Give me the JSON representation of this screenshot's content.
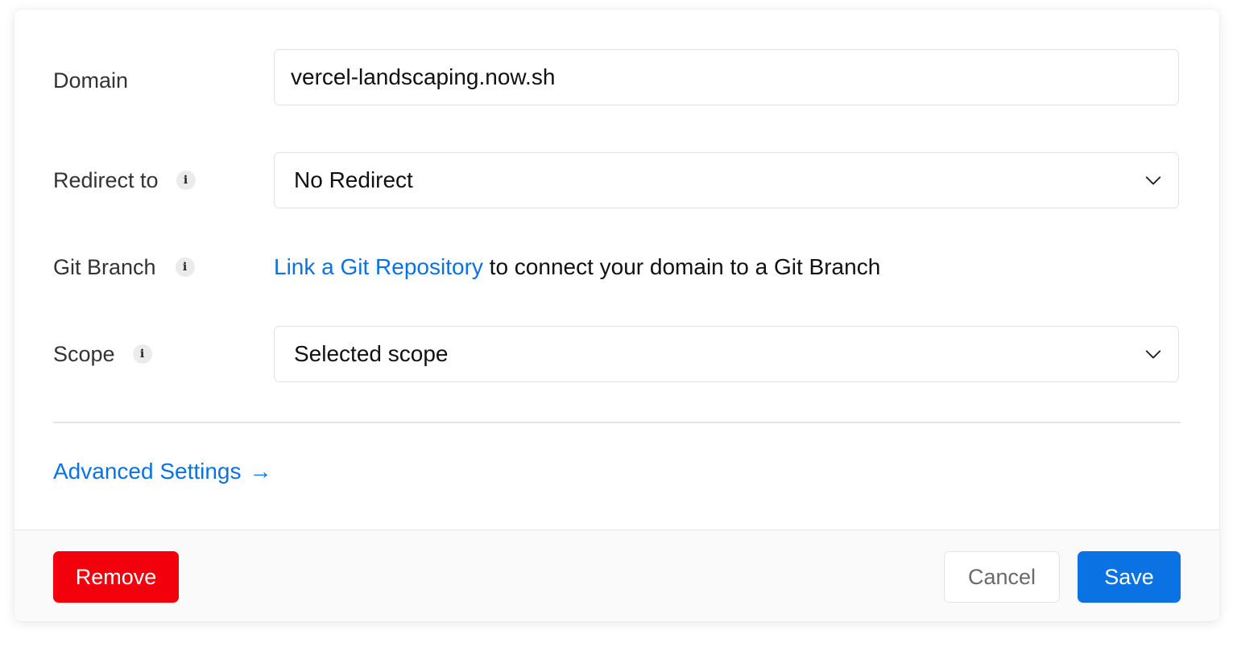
{
  "form": {
    "domain": {
      "label": "Domain",
      "value": "vercel-landscaping.now.sh"
    },
    "redirect": {
      "label": "Redirect to",
      "info_icon": "info-icon",
      "value": "No Redirect"
    },
    "git_branch": {
      "label": "Git Branch",
      "info_icon": "info-icon",
      "link_text": "Link a Git Repository",
      "suffix_text": " to connect your domain to a Git Branch"
    },
    "scope": {
      "label": "Scope",
      "info_icon": "info-icon",
      "value": "Selected scope"
    },
    "advanced_settings": {
      "label": "Advanced Settings",
      "arrow": "→"
    }
  },
  "footer": {
    "remove_label": "Remove",
    "cancel_label": "Cancel",
    "save_label": "Save"
  },
  "colors": {
    "accent": "#0a72e3",
    "danger": "#f2000b"
  }
}
